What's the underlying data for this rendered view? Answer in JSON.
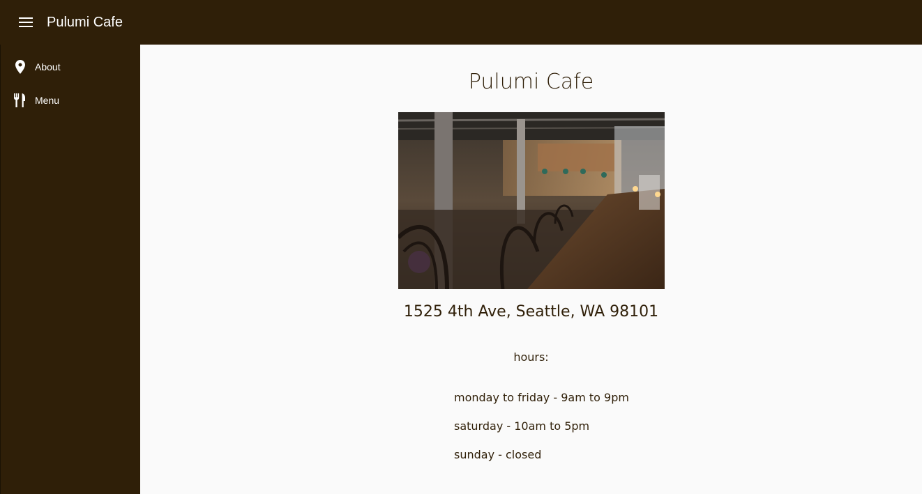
{
  "toolbar": {
    "menu_icon": "hamburger-menu-icon",
    "title": "Pulumi Cafe"
  },
  "sidenav": {
    "items": [
      {
        "label": "About",
        "icon": "location-pin-icon"
      },
      {
        "label": "Menu",
        "icon": "restaurant-icon"
      }
    ]
  },
  "main": {
    "title": "Pulumi Cafe",
    "address": "1525 4th Ave, Seattle, WA 98101",
    "hours_label": "hours:",
    "hours": [
      "monday to friday - 9am to 9pm",
      "saturday - 10am to 5pm",
      "sunday - closed"
    ]
  },
  "colors": {
    "toolbar_bg": "#2f1f08",
    "content_bg": "#fafafa",
    "text": "#2f1f08"
  }
}
